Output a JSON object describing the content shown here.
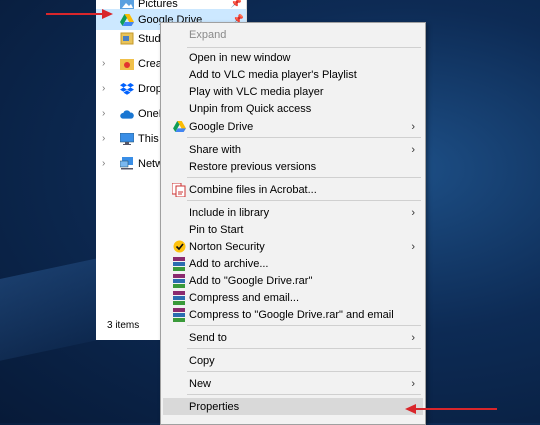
{
  "explorer": {
    "nav": [
      {
        "label": "Pictures",
        "icon": "pictures-folder-icon"
      },
      {
        "label": "Google Drive",
        "icon": "google-drive-icon"
      },
      {
        "label": "Stude",
        "icon": "student-folder-icon"
      },
      {
        "label": "Creativ",
        "icon": "creative-cloud-icon"
      },
      {
        "label": "Dropbo",
        "icon": "dropbox-icon"
      },
      {
        "label": "OneDri",
        "icon": "onedrive-icon"
      },
      {
        "label": "This PC",
        "icon": "this-pc-icon"
      },
      {
        "label": "Networ",
        "icon": "network-icon"
      }
    ],
    "status": "3 items"
  },
  "menu": {
    "items": {
      "expand": "Expand",
      "open_new_window": "Open in new window",
      "add_vlc_playlist": "Add to VLC media player's Playlist",
      "play_vlc": "Play with VLC media player",
      "unpin_quick_access": "Unpin from Quick access",
      "google_drive": "Google Drive",
      "share_with": "Share with",
      "restore_versions": "Restore previous versions",
      "combine_acrobat": "Combine files in Acrobat...",
      "include_library": "Include in library",
      "pin_start": "Pin to Start",
      "norton": "Norton Security",
      "add_archive": "Add to archive...",
      "add_rar": "Add to \"Google Drive.rar\"",
      "compress_email": "Compress and email...",
      "compress_rar_email": "Compress to \"Google Drive.rar\" and email",
      "send_to": "Send to",
      "copy": "Copy",
      "new": "New",
      "properties": "Properties"
    },
    "highlighted": "Properties"
  },
  "colors": {
    "annotation_arrow": "#d9262b",
    "selection": "#cce8ff",
    "menu_bg": "#f2f2f2"
  }
}
